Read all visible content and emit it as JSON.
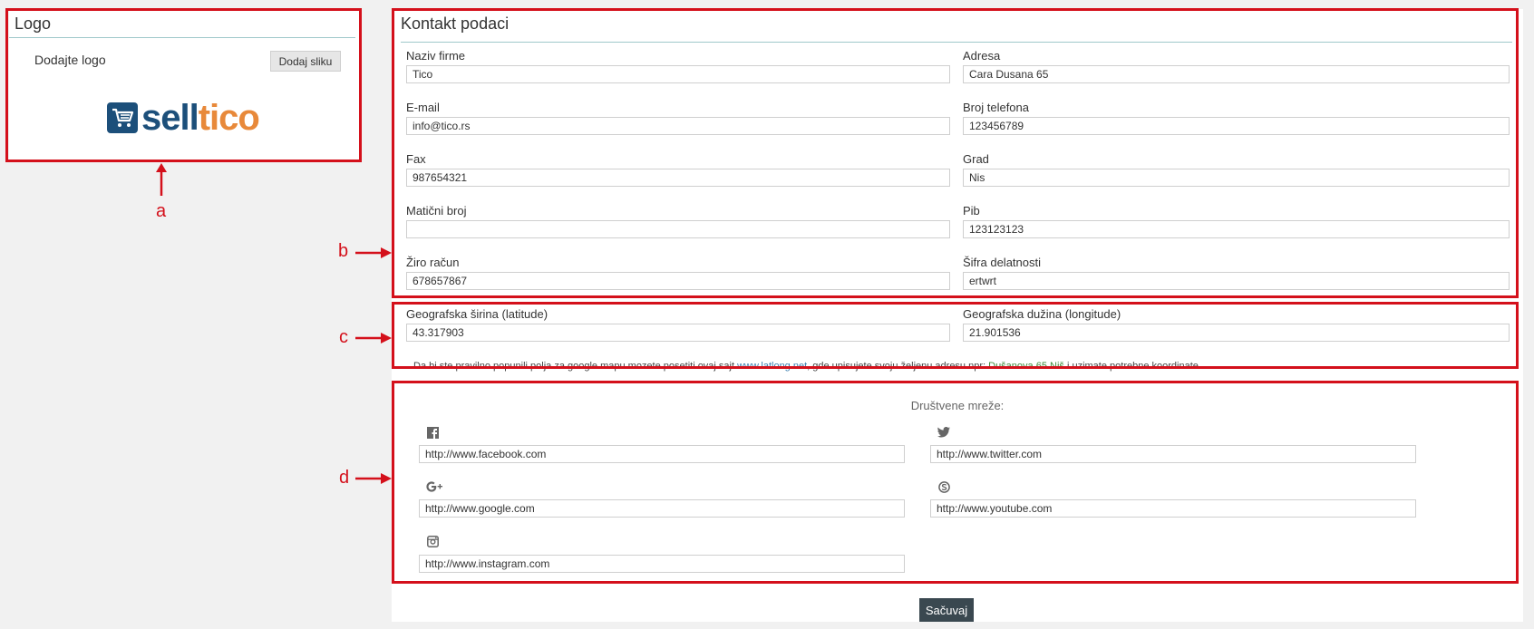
{
  "logo_panel": {
    "title": "Logo",
    "add_logo_label": "Dodajte logo",
    "add_image_button": "Dodaj sliku",
    "brand_sell": "sell",
    "brand_tico": "tico"
  },
  "contact": {
    "title": "Kontakt podaci",
    "fields": {
      "naziv_firme": {
        "label": "Naziv firme",
        "value": "Tico"
      },
      "adresa": {
        "label": "Adresa",
        "value": "Cara Dusana 65"
      },
      "email": {
        "label": "E-mail",
        "value": "info@tico.rs"
      },
      "telefon": {
        "label": "Broj telefona",
        "value": "123456789"
      },
      "fax": {
        "label": "Fax",
        "value": "987654321"
      },
      "grad": {
        "label": "Grad",
        "value": "Nis"
      },
      "maticni": {
        "label": "Matični broj",
        "value": ""
      },
      "pib": {
        "label": "Pib",
        "value": "123123123"
      },
      "ziro": {
        "label": "Žiro račun",
        "value": "678657867"
      },
      "sifra": {
        "label": "Šifra delatnosti",
        "value": "ertwrt"
      }
    }
  },
  "geo": {
    "latitude": {
      "label": "Geografska širina (latitude)",
      "value": "43.317903"
    },
    "longitude": {
      "label": "Geografska dužina (longitude)",
      "value": "21.901536"
    },
    "hint_prefix": "Da bi ste pravilno popunili polja za google mapu mozete posetiti ovaj sajt ",
    "hint_link": "www.latlong.net",
    "hint_middle": ", gde upisujete svoju željenu adresu npr: ",
    "hint_example": "Dušanova 65 Niš",
    "hint_suffix": " i uzimate potrebne koordinate."
  },
  "social": {
    "title": "Društvene mreže:",
    "facebook": {
      "icon": "facebook-icon",
      "value": "http://www.facebook.com"
    },
    "twitter": {
      "icon": "twitter-icon",
      "value": "http://www.twitter.com"
    },
    "google": {
      "icon": "google-plus-icon",
      "value": "http://www.google.com"
    },
    "skype": {
      "icon": "skype-icon",
      "value": "http://www.youtube.com"
    },
    "instagram": {
      "icon": "instagram-icon",
      "value": "http://www.instagram.com"
    }
  },
  "save_button": "Sačuvaj",
  "annotations": {
    "a": "a",
    "b": "b",
    "c": "c",
    "d": "d"
  },
  "colors": {
    "annotation": "#d4101b",
    "brand_blue": "#1c4f7a",
    "brand_orange": "#e8893a",
    "save_bg": "#3a4850"
  }
}
